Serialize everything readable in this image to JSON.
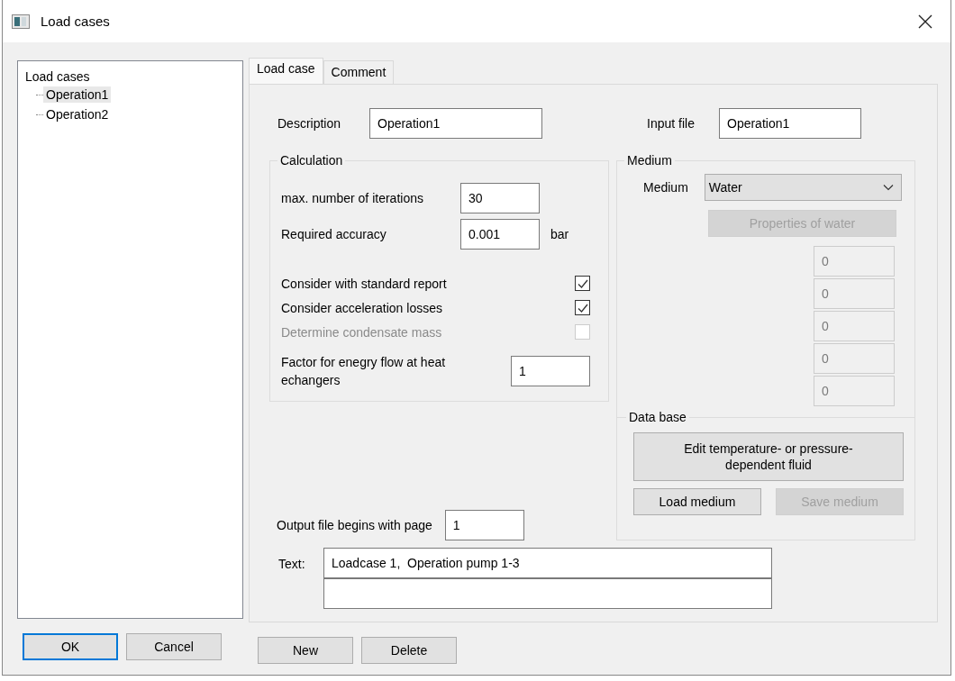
{
  "window": {
    "title": "Load cases"
  },
  "tree": {
    "label": "Load cases",
    "children": [
      {
        "label": "Operation1",
        "selected": true
      },
      {
        "label": "Operation2",
        "selected": false
      }
    ]
  },
  "tabs": [
    {
      "label": "Load case",
      "selected": true
    },
    {
      "label": "Comment",
      "selected": false
    }
  ],
  "description": {
    "label": "Description",
    "value": "Operation1"
  },
  "input_file": {
    "label": "Input file",
    "value": "Operation1"
  },
  "calculation": {
    "title": "Calculation",
    "fields": [
      {
        "label": "max. number of iterations",
        "value": "30"
      },
      {
        "label": "Required accuracy",
        "value": "0.001",
        "unit": "bar"
      }
    ],
    "checks": [
      {
        "label": "Consider with standard report",
        "checked": true,
        "disabled": false
      },
      {
        "label": "Consider acceleration losses",
        "checked": true,
        "disabled": false
      },
      {
        "label": "Determine condensate mass",
        "checked": false,
        "disabled": true
      }
    ],
    "factor": {
      "label": "Factor for enegry flow at heat echangers",
      "value": "1"
    }
  },
  "medium": {
    "title": "Medium",
    "label": "Medium",
    "value": "Water",
    "properties_button": {
      "label": "Properties of water",
      "disabled": true
    },
    "values": [
      {
        "value": "0",
        "disabled": true
      },
      {
        "value": "0",
        "disabled": true
      },
      {
        "value": "0",
        "disabled": true
      },
      {
        "value": "0",
        "disabled": true
      },
      {
        "value": "0",
        "disabled": true
      }
    ]
  },
  "data_base": {
    "title": "Data base",
    "edit_button": {
      "label": "Edit temperature- or pressure-dependent fluid",
      "disabled": false
    },
    "buttons": [
      {
        "label": "Load medium",
        "disabled": false
      },
      {
        "label": "Save medium",
        "disabled": true
      }
    ]
  },
  "output_file": {
    "label": "Output file begins with page",
    "value": "1"
  },
  "text": {
    "label": "Text:",
    "value": "Loadcase 1,  Operation pump 1-3"
  },
  "dialog_buttons": [
    {
      "label": "OK",
      "default": true
    },
    {
      "label": "Cancel",
      "default": false
    }
  ],
  "list_buttons": [
    {
      "label": "New"
    },
    {
      "label": "Delete"
    }
  ]
}
